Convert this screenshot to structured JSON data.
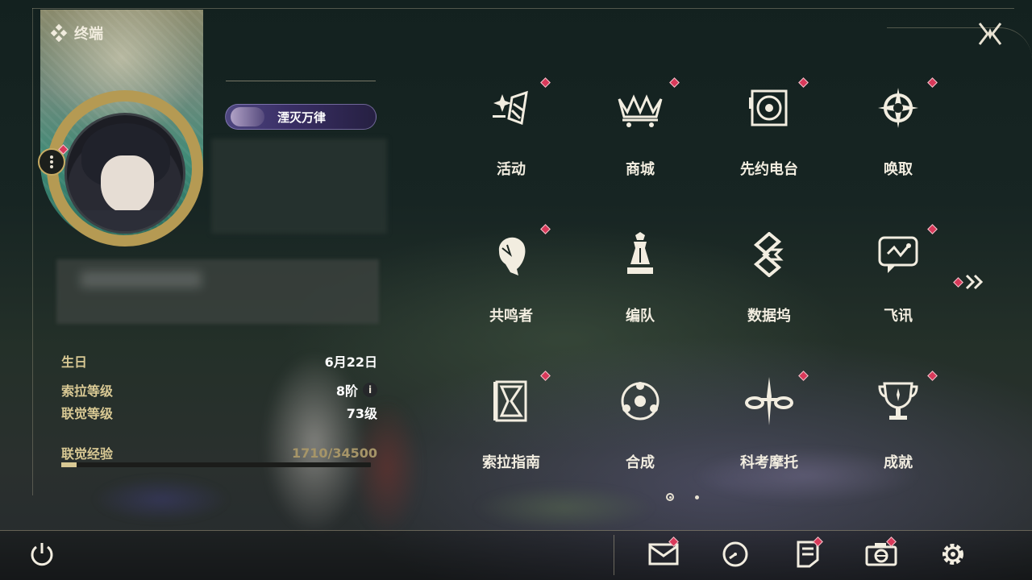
{
  "header": {
    "title": "终端"
  },
  "profile": {
    "title_badge": "湮灭万律"
  },
  "stats": [
    {
      "label": "生日",
      "value": "6月22日"
    },
    {
      "label": "索拉等级",
      "value": "8阶",
      "info": "i"
    },
    {
      "label": "联觉等级",
      "value": "73级"
    }
  ],
  "exp": {
    "label": "联觉经验",
    "value": "1710/34500",
    "current": 1710,
    "max": 34500
  },
  "menu": [
    {
      "label": "活动",
      "icon": "sparkle-flag-icon",
      "badge": true
    },
    {
      "label": "商城",
      "icon": "shop-cart-icon",
      "badge": true
    },
    {
      "label": "先约电台",
      "icon": "radio-record-icon",
      "badge": true
    },
    {
      "label": "唤取",
      "icon": "compass-star-icon",
      "badge": true
    },
    {
      "label": "共鸣者",
      "icon": "character-head-icon",
      "badge": true
    },
    {
      "label": "编队",
      "icon": "chess-piece-icon",
      "badge": false
    },
    {
      "label": "数据坞",
      "icon": "data-dock-icon",
      "badge": false
    },
    {
      "label": "飞讯",
      "icon": "chat-bubble-icon",
      "badge": true
    },
    {
      "label": "索拉指南",
      "icon": "guide-book-icon",
      "badge": true
    },
    {
      "label": "合成",
      "icon": "synthesis-icon",
      "badge": false
    },
    {
      "label": "科考摩托",
      "icon": "motorbike-icon",
      "badge": true
    },
    {
      "label": "成就",
      "icon": "trophy-icon",
      "badge": true
    }
  ],
  "pager": {
    "current": 1,
    "total": 2
  },
  "bottom": [
    "power-icon",
    "mail-icon",
    "clock-icon",
    "notes-icon",
    "camera-icon",
    "settings-gear-icon"
  ],
  "colors": {
    "accent": "#d9c994",
    "badge": "#d9395a",
    "ring": "#b59a53"
  }
}
